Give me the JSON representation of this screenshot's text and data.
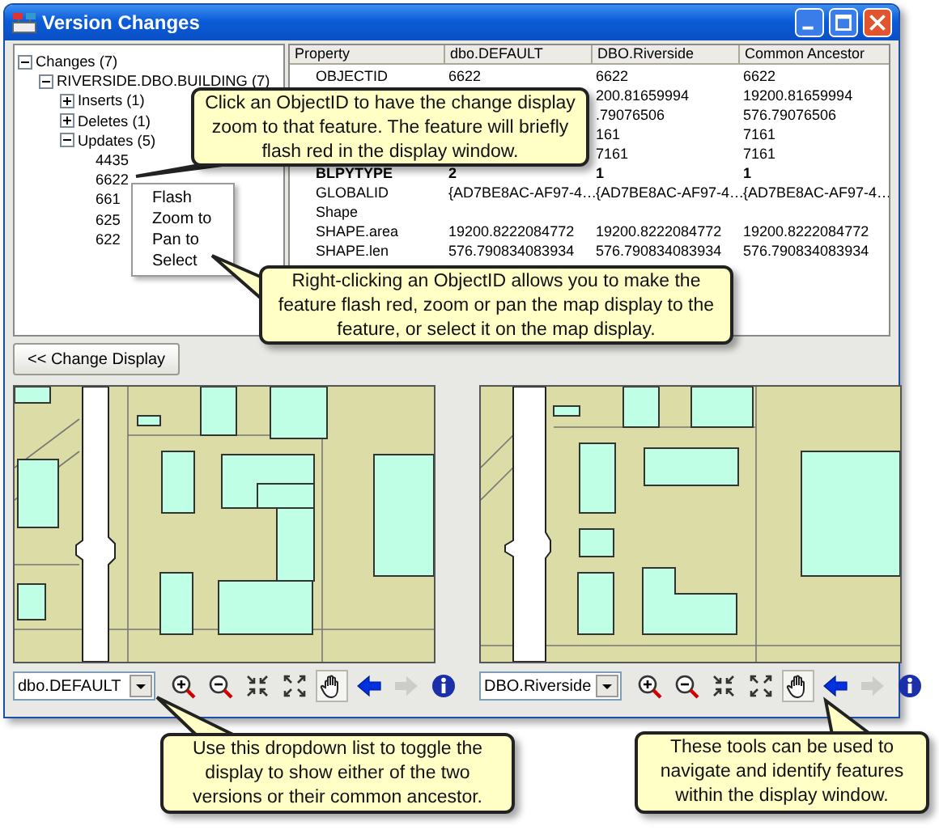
{
  "window": {
    "title": "Version Changes"
  },
  "tree": {
    "label": "Changes (7)",
    "expanded": true,
    "children": [
      {
        "label": "RIVERSIDE.DBO.BUILDING (7)",
        "expanded": true,
        "children": [
          {
            "label": "Inserts (1)",
            "expanded": false
          },
          {
            "label": "Deletes (1)",
            "expanded": false
          },
          {
            "label": "Updates (5)",
            "expanded": true,
            "children": [
              {
                "label": "4435"
              },
              {
                "label": "6622"
              },
              {
                "label": "661"
              },
              {
                "label": "625"
              },
              {
                "label": "622"
              }
            ]
          }
        ]
      }
    ]
  },
  "context_menu": [
    "Flash",
    "Zoom to",
    "Pan to",
    "Select"
  ],
  "table": {
    "columns": [
      "Property",
      "dbo.DEFAULT",
      "DBO.Riverside",
      "Common Ancestor"
    ],
    "rows": [
      {
        "bold": false,
        "cells": [
          "OBJECTID",
          "6622",
          "6622",
          "6622"
        ]
      },
      {
        "bold": false,
        "cells": [
          null,
          null,
          "200.81659994",
          "19200.81659994"
        ]
      },
      {
        "bold": false,
        "cells": [
          null,
          null,
          ".79076506",
          "576.79076506"
        ]
      },
      {
        "bold": false,
        "cells": [
          null,
          null,
          "161",
          "7161"
        ]
      },
      {
        "bold": false,
        "cells": [
          null,
          null,
          "7161",
          "7161"
        ]
      },
      {
        "bold": true,
        "cells": [
          "BLPYTYPE",
          "2",
          "1",
          "1"
        ]
      },
      {
        "bold": false,
        "cells": [
          "GLOBALID",
          "{AD7BE8AC-AF97-4…",
          "{AD7BE8AC-AF97-4…",
          "{AD7BE8AC-AF97-4…"
        ]
      },
      {
        "bold": false,
        "cells": [
          "Shape",
          null,
          null,
          null
        ]
      },
      {
        "bold": false,
        "cells": [
          "SHAPE.area",
          "19200.8222084772",
          "19200.8222084772",
          "19200.8222084772"
        ]
      },
      {
        "bold": false,
        "cells": [
          "SHAPE.len",
          "576.790834083934",
          "576.790834083934",
          "576.790834083934"
        ]
      }
    ]
  },
  "change_display_button": "<< Change Display",
  "panels": [
    {
      "version": "dbo.DEFAULT",
      "tools": [
        {
          "kind": "zoom-in",
          "selected": false,
          "disabled": false
        },
        {
          "kind": "zoom-out",
          "selected": false,
          "disabled": false
        },
        {
          "kind": "fixed-zoom-in",
          "selected": false,
          "disabled": false
        },
        {
          "kind": "fixed-zoom-out",
          "selected": false,
          "disabled": false
        },
        {
          "kind": "pan",
          "selected": true,
          "disabled": false
        },
        {
          "kind": "back",
          "selected": false,
          "disabled": false
        },
        {
          "kind": "forward",
          "selected": false,
          "disabled": true
        },
        {
          "kind": "identify",
          "selected": false,
          "disabled": false
        }
      ]
    },
    {
      "version": "DBO.Riverside",
      "tools": [
        {
          "kind": "zoom-in",
          "selected": false,
          "disabled": false
        },
        {
          "kind": "zoom-out",
          "selected": false,
          "disabled": false
        },
        {
          "kind": "fixed-zoom-in",
          "selected": false,
          "disabled": false
        },
        {
          "kind": "fixed-zoom-out",
          "selected": false,
          "disabled": false
        },
        {
          "kind": "pan",
          "selected": true,
          "disabled": false
        },
        {
          "kind": "back",
          "selected": false,
          "disabled": false
        },
        {
          "kind": "forward",
          "selected": false,
          "disabled": true
        },
        {
          "kind": "identify",
          "selected": false,
          "disabled": false
        }
      ]
    }
  ],
  "callouts": [
    {
      "text": "Click an ObjectID to have the change display zoom to that feature. The feature will briefly flash red in the display window."
    },
    {
      "text": "Right-clicking an ObjectID allows you to make the feature flash red, zoom or pan the map display to the feature, or select it on the map display."
    },
    {
      "text": "Use this dropdown list to toggle the display to show either of the two versions or their common ancestor."
    },
    {
      "text": "These tools can be used to navigate and identify features within the display window."
    }
  ]
}
